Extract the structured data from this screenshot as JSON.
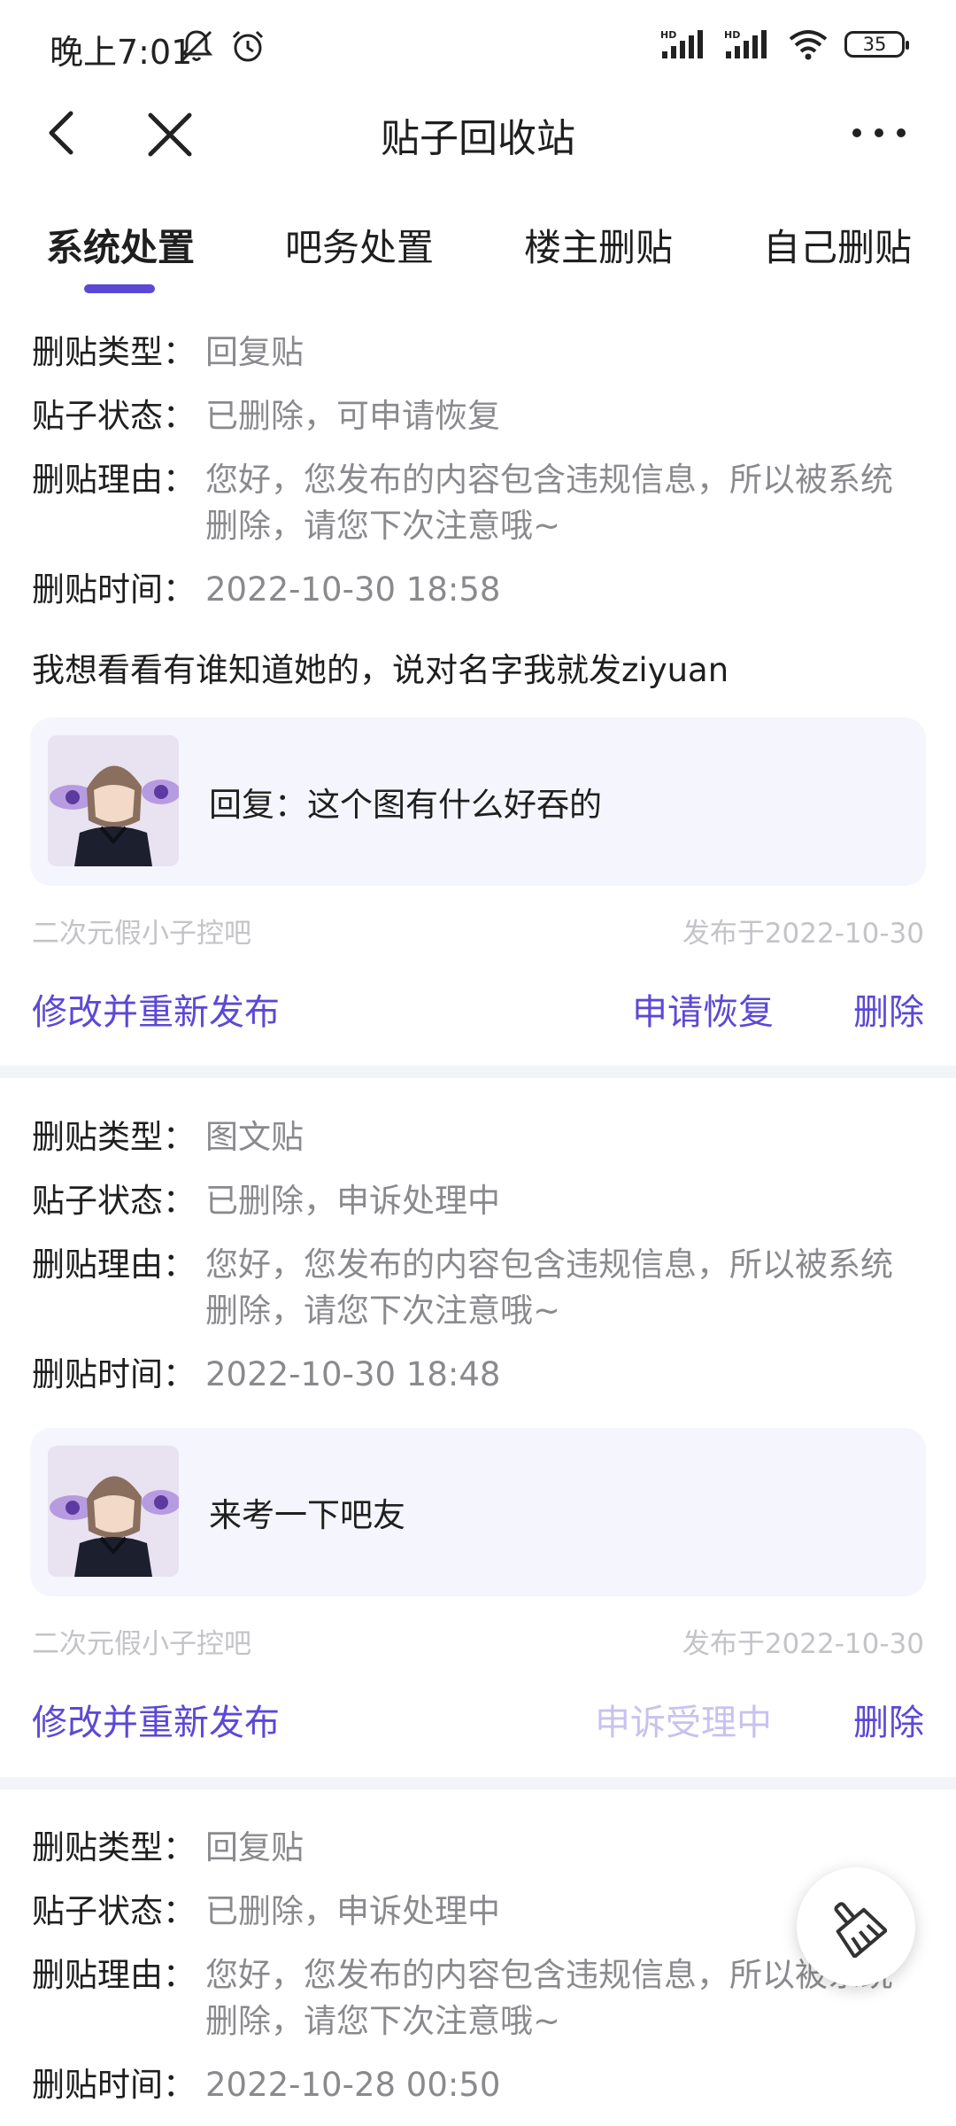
{
  "status_bar": {
    "time": "晚上7:01",
    "battery": "35",
    "signal_labels": [
      "HD",
      "HD"
    ]
  },
  "nav": {
    "title": "贴子回收站"
  },
  "tabs": [
    {
      "label": "系统处置",
      "active": true
    },
    {
      "label": "吧务处置",
      "active": false
    },
    {
      "label": "楼主删贴",
      "active": false
    },
    {
      "label": "自己删贴",
      "active": false
    }
  ],
  "labels": {
    "type": "删贴类型：",
    "status": "贴子状态：",
    "reason": "删贴理由：",
    "time": "删贴时间："
  },
  "posts": [
    {
      "type": "回复贴",
      "status": "已删除，可申请恢复",
      "reason": "您好，您发布的内容包含违规信息，所以被系统删除，请您下次注意哦~",
      "time": "2022-10-30 18:58",
      "content": "我想看看有谁知道她的，说对名字我就发ziyuan",
      "quote": "回复：这个图有什么好吞的",
      "forum": "二次元假小子控吧",
      "published": "发布于2022-10-30",
      "action_edit": "修改并重新发布",
      "action_second": "申请恢复",
      "action_delete": "删除"
    },
    {
      "type": "图文贴",
      "status": "已删除，申诉处理中",
      "reason": "您好，您发布的内容包含违规信息，所以被系统删除，请您下次注意哦~",
      "time": "2022-10-30 18:48",
      "quote": "来考一下吧友",
      "forum": "二次元假小子控吧",
      "published": "发布于2022-10-30",
      "action_edit": "修改并重新发布",
      "action_second": "申诉受理中",
      "action_delete": "删除"
    },
    {
      "type": "回复贴",
      "status": "已删除，申诉处理中",
      "reason": "您好，您发布的内容包含违规信息，所以被系统删除，请您下次注意哦~",
      "time": "2022-10-28 00:50"
    }
  ],
  "colors": {
    "accent": "#5b49d6",
    "accent_disabled": "#c8c2ef",
    "muted": "#8a8a8e",
    "quote_bg": "#f5f5fd"
  },
  "icons": {
    "back": "chevron-left-icon",
    "close": "close-icon",
    "more": "more-dots-icon",
    "fab": "broom-icon"
  }
}
